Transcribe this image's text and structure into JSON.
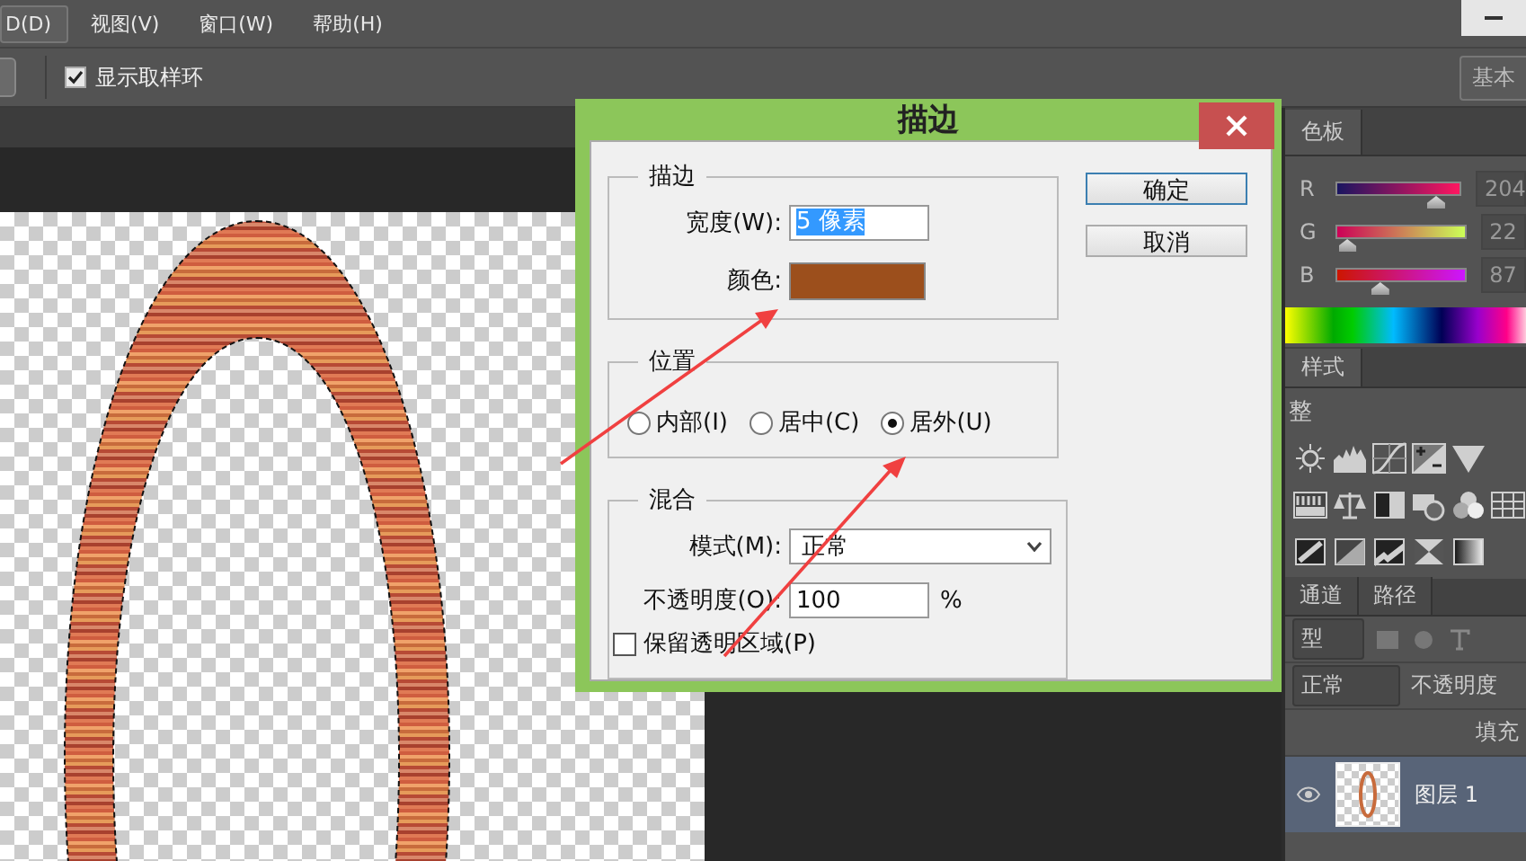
{
  "menu": [
    {
      "label": "D(D)",
      "selected": true
    },
    {
      "label": "视图(V)",
      "selected": false
    },
    {
      "label": "窗口(W)",
      "selected": false
    },
    {
      "label": "帮助(H)",
      "selected": false
    }
  ],
  "options_bar": {
    "sample_ring": {
      "label": "显示取样环",
      "checked": true
    },
    "workspace_button": "基本"
  },
  "dialog": {
    "title": "描边",
    "stroke": {
      "legend": "描边",
      "width_label": "宽度(W):",
      "width_value": "5 像素",
      "width_value_selected": true,
      "color_label": "颜色:",
      "color": "#9c4f1c"
    },
    "position": {
      "legend": "位置",
      "options": [
        {
          "label": "内部(I)",
          "selected": false
        },
        {
          "label": "居中(C)",
          "selected": false
        },
        {
          "label": "居外(U)",
          "selected": true
        }
      ]
    },
    "blend": {
      "legend": "混合",
      "mode_label": "模式(M):",
      "mode_value": "正常",
      "opacity_label": "不透明度(O):",
      "opacity_value": "100",
      "opacity_unit": "%",
      "preserve": {
        "label": "保留透明区域(P)",
        "checked": false
      }
    },
    "buttons": [
      {
        "label": "确定",
        "default": true
      },
      {
        "label": "取消",
        "default": false
      }
    ]
  },
  "color_panel": {
    "tab": "色板",
    "channels": [
      {
        "name": "R",
        "level": 0.8,
        "reading": "204"
      },
      {
        "name": "G",
        "level": 0.086,
        "reading": "22"
      },
      {
        "name": "B",
        "level": 0.34,
        "reading": "87"
      }
    ]
  },
  "styles_panel": {
    "tab": "样式"
  },
  "adjustments": {
    "title": "整"
  },
  "layers_panel": {
    "tabs": [
      "通道",
      "路径"
    ],
    "filter": "型",
    "blend_mode": "正常",
    "opacity_label": "不透明度",
    "fill_label": "填充",
    "layers": [
      {
        "name": "图层 1",
        "visible": true,
        "selected": true
      }
    ]
  }
}
